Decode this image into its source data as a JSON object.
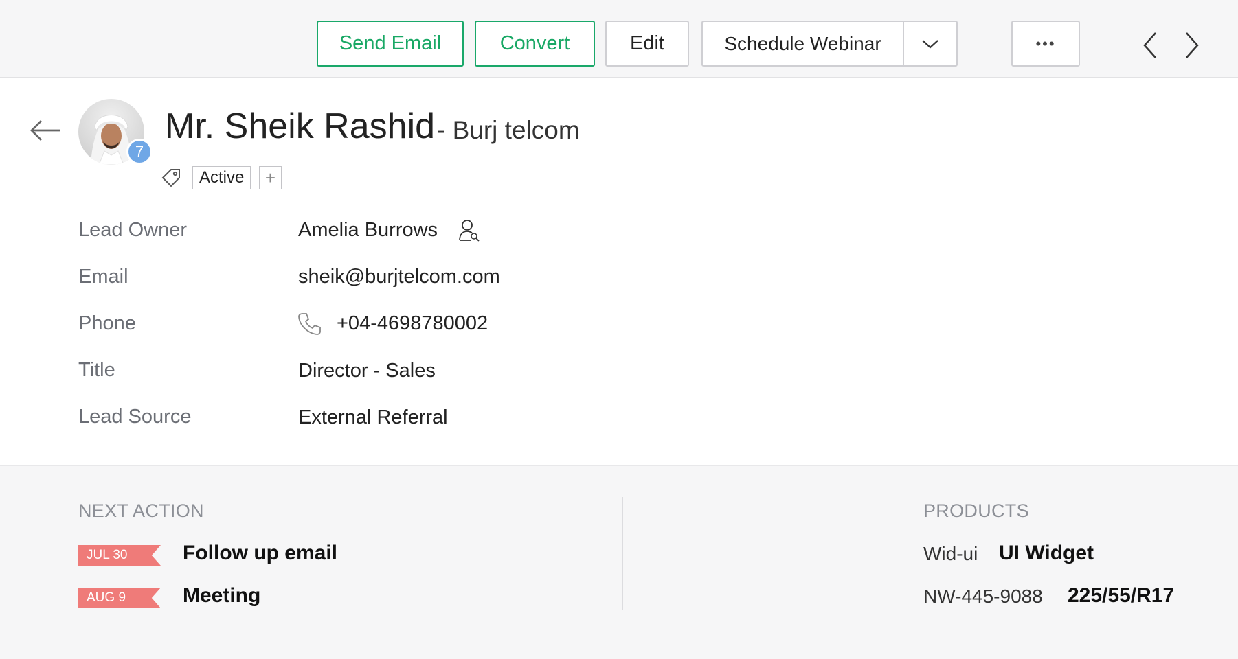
{
  "toolbar": {
    "send_email": "Send Email",
    "convert": "Convert",
    "edit": "Edit",
    "schedule_webinar": "Schedule Webinar",
    "more": "•••"
  },
  "lead": {
    "name": "Mr. Sheik Rashid",
    "company": "- Burj telcom",
    "badge_count": "7",
    "tag": "Active",
    "tag_add": "+"
  },
  "fields": [
    {
      "label": "Lead Owner",
      "value": "Amelia Burrows"
    },
    {
      "label": "Email",
      "value": "sheik@burjtelcom.com"
    },
    {
      "label": "Phone",
      "value": "+04-4698780002"
    },
    {
      "label": "Title",
      "value": "Director - Sales"
    },
    {
      "label": "Lead Source",
      "value": "External Referral"
    }
  ],
  "next_action": {
    "title": "NEXT ACTION",
    "items": [
      {
        "date": "JUL 30",
        "text": "Follow up email"
      },
      {
        "date": "AUG 9",
        "text": "Meeting"
      }
    ]
  },
  "products": {
    "title": "PRODUCTS",
    "items": [
      {
        "code": "Wid-ui",
        "name": "UI Widget"
      },
      {
        "code": "NW-445-9088",
        "name": "225/55/R17"
      }
    ]
  },
  "colors": {
    "accent_green": "#19a865",
    "date_tag": "#ef7b79",
    "badge": "#6fa7e6"
  },
  "icons": [
    "chevron-down-icon",
    "chevron-left-icon",
    "chevron-right-icon",
    "back-arrow-icon",
    "tag-icon",
    "owner-icon",
    "phone-icon"
  ]
}
